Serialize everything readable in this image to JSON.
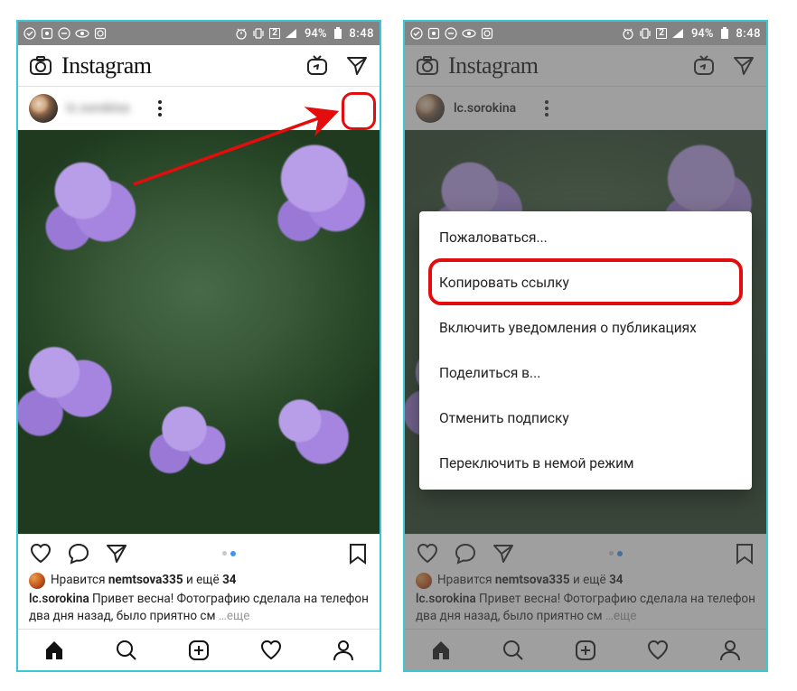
{
  "statusbar": {
    "battery_pct": "94%",
    "time": "8:48",
    "sim_slot": "2"
  },
  "header": {
    "logo_text": "Instagram"
  },
  "post_left": {
    "username_display": "lc.sorokina"
  },
  "post_right": {
    "username": "lc.sorokina"
  },
  "likes": {
    "prefix": "Нравится ",
    "liker": "nemtsova335",
    "and_more": " и ещё ",
    "count": "34"
  },
  "caption": {
    "user": "lc.sorokina",
    "text": " Привет весна! Фотографию сделала на телефон два дня назад, было приятно см",
    "more": " …еще"
  },
  "popup": {
    "items": [
      "Пожаловаться...",
      "Копировать ссылку",
      "Включить уведомления о публикациях",
      "Поделиться в...",
      "Отменить подписку",
      "Переключить в немой режим"
    ]
  }
}
